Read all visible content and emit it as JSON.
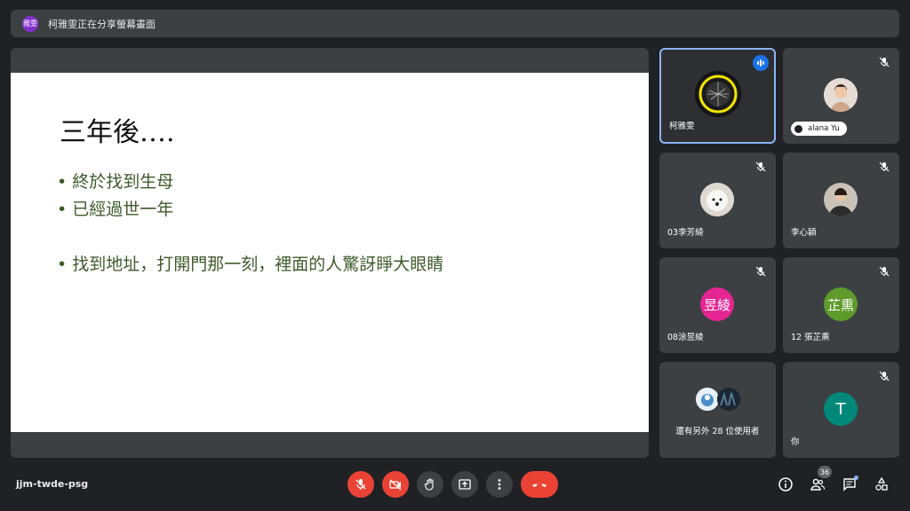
{
  "topbar": {
    "presenter_avatar_text": "雅雯",
    "sharing_text": "柯雅雯正在分享螢幕畫面"
  },
  "slide": {
    "title": "三年後….",
    "bullets": [
      "終於找到生母",
      "已經過世一年",
      "找到地址，打開門那一刻，裡面的人驚訝睜大眼睛"
    ],
    "bullet_mark": "•"
  },
  "participants": {
    "p1": {
      "name": "柯雅雯",
      "speaking": true
    },
    "p2": {
      "name": "alana Yu",
      "muted": true
    },
    "p3": {
      "name": "03李芳綺",
      "muted": true
    },
    "p4": {
      "name": "李心穎",
      "muted": true
    },
    "p5": {
      "name": "08涂昱綾",
      "avatar_text": "昱綾",
      "avatar_color": "#e52592",
      "muted": true
    },
    "p6": {
      "name": "12 張芷熏",
      "avatar_text": "芷熏",
      "avatar_color": "#5e9b2b",
      "muted": true
    },
    "others": {
      "label": "還有另外 28 位使用者"
    },
    "self": {
      "name": "你",
      "avatar_text": "T",
      "avatar_color": "#00897b",
      "muted": true
    }
  },
  "bottombar": {
    "meeting_code": "jjm-twde-psg",
    "people_count": "36"
  },
  "colors": {
    "accent": "#8ab4f8",
    "danger": "#ea4335",
    "surface": "#3c4043",
    "background": "#202124"
  }
}
